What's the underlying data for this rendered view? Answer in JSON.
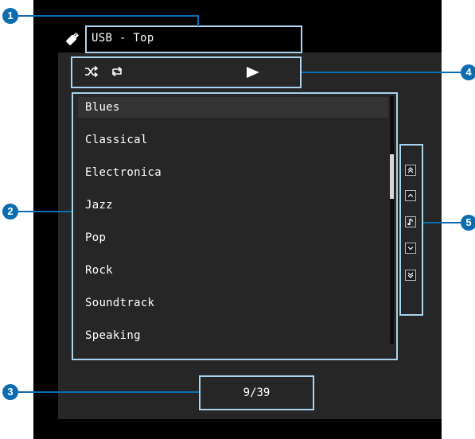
{
  "header": {
    "title": "USB - Top",
    "source_icon": "usb-stick-icon"
  },
  "toolbar": {
    "shuffle_icon": "shuffle-icon",
    "repeat_icon": "repeat-icon",
    "play_icon": "play-icon"
  },
  "list": {
    "items": [
      {
        "label": "Blues",
        "selected": true
      },
      {
        "label": "Classical",
        "selected": false
      },
      {
        "label": "Electronica",
        "selected": false
      },
      {
        "label": "Jazz",
        "selected": false
      },
      {
        "label": "Pop",
        "selected": false
      },
      {
        "label": "Rock",
        "selected": false
      },
      {
        "label": "Soundtrack",
        "selected": false
      },
      {
        "label": "Speaking",
        "selected": false
      }
    ]
  },
  "navigation": {
    "buttons": [
      "page-up-icon",
      "line-up-icon",
      "now-playing-icon",
      "line-down-icon",
      "page-down-icon"
    ]
  },
  "footer": {
    "page_count": "9/39"
  },
  "callouts": {
    "c1": "1",
    "c2": "2",
    "c3": "3",
    "c4": "4",
    "c5": "5"
  },
  "colors": {
    "highlight_border": "#a9d3ef",
    "callout": "#0b6db0",
    "screen_bg": "#000000",
    "panel_bg": "#262626"
  }
}
